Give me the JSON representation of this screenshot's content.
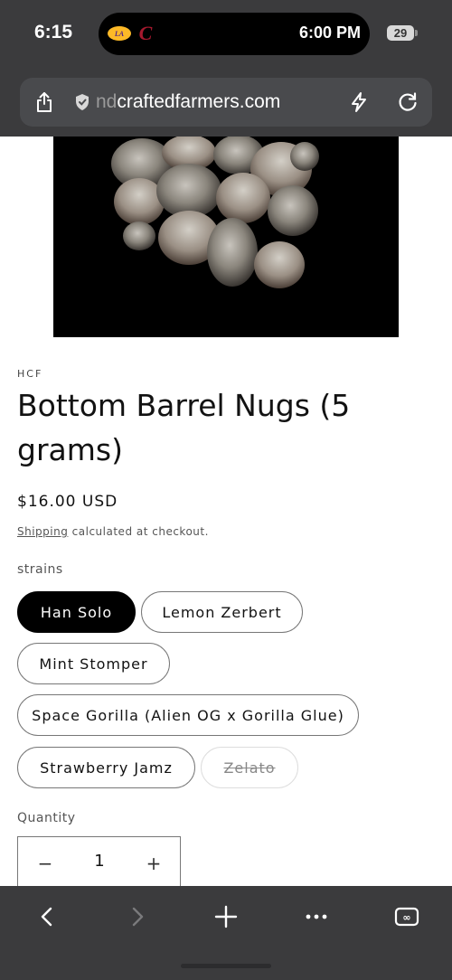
{
  "status_bar": {
    "time": "6:15",
    "live_activity_time": "6:00 PM",
    "battery_level": "29",
    "live_activity_logos": [
      "lakers-logo-icon",
      "cavaliers-logo-icon"
    ]
  },
  "url_bar": {
    "host_faded": "nd",
    "host_main": "craftedfarmers.com",
    "icons": [
      "share-icon",
      "shield-icon",
      "lightning-icon",
      "reload-icon"
    ]
  },
  "product": {
    "vendor": "HCF",
    "title": "Bottom Barrel Nugs (5 grams)",
    "price": "$16.00 USD",
    "shipping_link": "Shipping",
    "shipping_rest": " calculated at checkout.",
    "variant_label": "strains",
    "variants": [
      {
        "label": "Han Solo",
        "state": "selected"
      },
      {
        "label": "Lemon Zerbert",
        "state": "available"
      },
      {
        "label": "Mint Stomper",
        "state": "available"
      },
      {
        "label": "Space Gorilla (Alien OG x Gorilla Glue)",
        "state": "available"
      },
      {
        "label": "Strawberry Jamz",
        "state": "available"
      },
      {
        "label": "Zelato",
        "state": "unavailable"
      }
    ],
    "quantity_label": "Quantity",
    "quantity_value": "1",
    "quantity_minus": "−",
    "quantity_plus": "+"
  },
  "toolbar": {
    "icons": [
      "back-icon",
      "forward-icon",
      "new-tab-icon",
      "more-icon",
      "tabs-icon"
    ],
    "tabs_glyph": "∞"
  },
  "colors": {
    "browser_chrome": "#3b3b3d",
    "url_field": "#494a4d",
    "selected_pill": "#000000",
    "text": "#121212"
  }
}
